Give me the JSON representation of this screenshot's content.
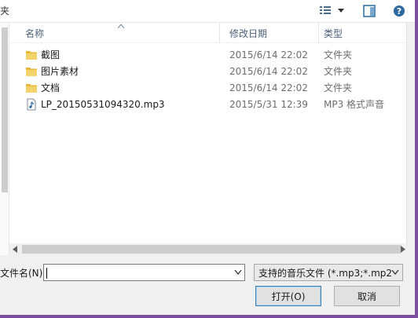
{
  "toolbar": {
    "label": "夹"
  },
  "columns": {
    "name": "名称",
    "date": "修改日期",
    "type": "类型"
  },
  "files": [
    {
      "name": "截图",
      "date": "2015/6/14 22:02",
      "type": "文件夹",
      "icon": "folder-icon"
    },
    {
      "name": "图片素材",
      "date": "2015/6/14 22:02",
      "type": "文件夹",
      "icon": "folder-icon"
    },
    {
      "name": "文档",
      "date": "2015/6/14 22:02",
      "type": "文件夹",
      "icon": "folder-icon"
    },
    {
      "name": "LP_20150531094320.mp3",
      "date": "2015/5/31 12:39",
      "type": "MP3 格式声音",
      "icon": "audio-file-icon"
    }
  ],
  "bottom": {
    "filename_label": "文件名(N):",
    "filename_value": "",
    "filetype": "支持的音乐文件 (*.mp3;*.mp2",
    "open_label": "打开(O)",
    "cancel_label": "取消"
  },
  "colors": {
    "frame": "#7b4f9d",
    "folder": "#e8b839",
    "accent": "#3c7fb1"
  }
}
